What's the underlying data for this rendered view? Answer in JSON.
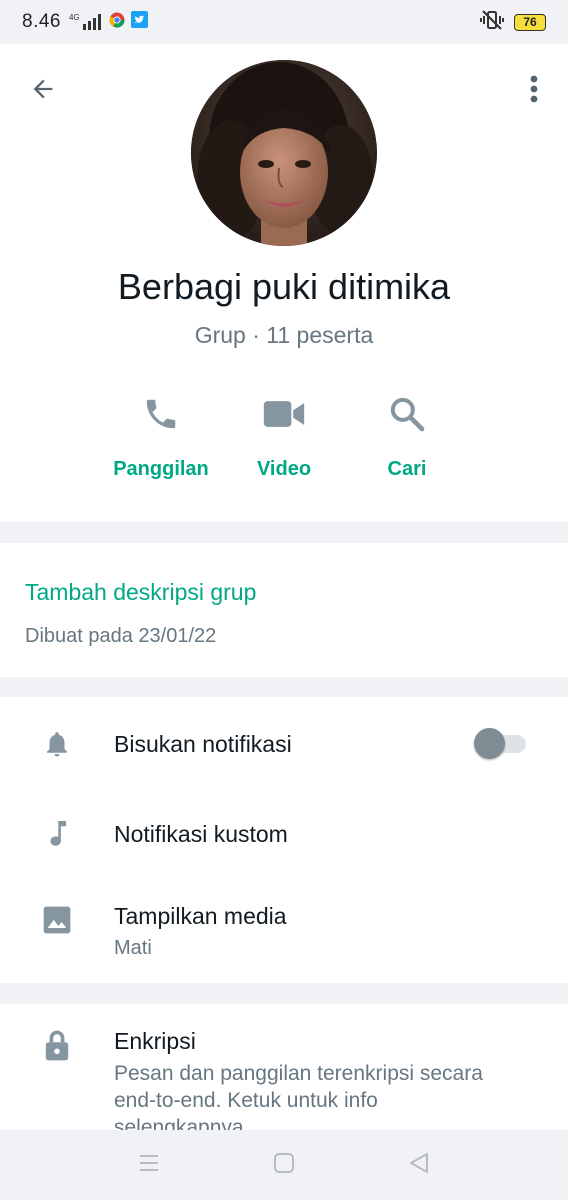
{
  "status_bar": {
    "time": "8.46",
    "network": "4G",
    "battery": "76",
    "icons": [
      "signal-icon",
      "chrome-icon",
      "twitter-icon",
      "vibrate-icon",
      "battery-icon"
    ]
  },
  "header": {
    "back_icon": "arrow-back-icon",
    "menu_icon": "more-vert-icon",
    "group_name": "Berbagi puki ditimika",
    "group_subtitle": "Grup · 11 peserta"
  },
  "actions": [
    {
      "label": "Panggilan",
      "icon": "phone-icon"
    },
    {
      "label": "Video",
      "icon": "videocam-icon"
    },
    {
      "label": "Cari",
      "icon": "search-icon"
    }
  ],
  "description": {
    "add_label": "Tambah deskripsi grup",
    "created_label": "Dibuat pada 23/01/22"
  },
  "settings": [
    {
      "title": "Bisukan notifikasi",
      "icon": "bell-icon",
      "toggle_on": false
    },
    {
      "title": "Notifikasi kustom",
      "icon": "music-note-icon"
    },
    {
      "title": "Tampilkan media",
      "subtitle": "Mati",
      "icon": "image-icon"
    }
  ],
  "encryption": {
    "title": "Enkripsi",
    "description": "Pesan dan panggilan terenkripsi secara end-to-end. Ketuk untuk info selengkapnya.",
    "icon": "lock-icon"
  },
  "navbar": {
    "icons": [
      "recent-apps-icon",
      "home-icon",
      "back-triangle-icon"
    ]
  },
  "colors": {
    "accent": "#00a884",
    "icon_gray": "#8696a0",
    "background": "#f0f2f5"
  }
}
